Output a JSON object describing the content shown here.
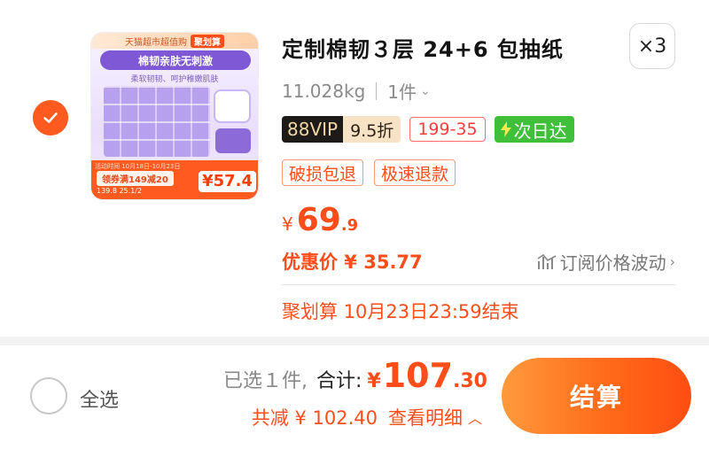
{
  "item": {
    "title": "定制棉韧３层 24+6 包抽纸",
    "quantity": "×3",
    "spec_weight": "11.028kg",
    "spec_count": "1件",
    "vip_label": "88VIP",
    "vip_discount": "9.5折",
    "coupon": "199-35",
    "delivery": "次日达",
    "service_tags": [
      "破损包退",
      "极速退款"
    ],
    "price_currency": "¥",
    "price_int": "69",
    "price_dec": ".9",
    "discount_text": "优惠价 ¥ 35.77",
    "subscribe_text": "订阅价格波动",
    "promo_end": "聚划算 10月23日23:59结束",
    "thumb": {
      "top_band": "天猫超市超值购",
      "top_band_tag": "聚划算",
      "headline": "棉韧亲肤无刺激",
      "sub": "柔软韧韧、呵护稚嫩肌肤",
      "date": "活动时间 10月18日-10月23日",
      "coupon": "领券满149减20",
      "mini": "139.8    25.1/2",
      "big_price": "¥57.4"
    }
  },
  "footer": {
    "select_all": "全选",
    "selected": "已选１件,",
    "total_label": "合计:",
    "total_currency": "¥",
    "total_int": "107",
    "total_dec": ".30",
    "reduce": "共减 ¥ 102.40",
    "detail": "查看明细",
    "checkout": "结算"
  },
  "colors": {
    "accent": "#ff4d1a",
    "checkout_gradient_start": "#ff9a3c",
    "checkout_gradient_end": "#ff4d12",
    "nextday_green": "#3fbf3a",
    "vip_dark": "#1e1a17"
  },
  "icons": {
    "checked": "check-icon",
    "lightning": "lightning-icon",
    "subscribe": "price-chart-icon",
    "chevron": "chevron-right-icon",
    "caret": "caret-up-icon"
  }
}
